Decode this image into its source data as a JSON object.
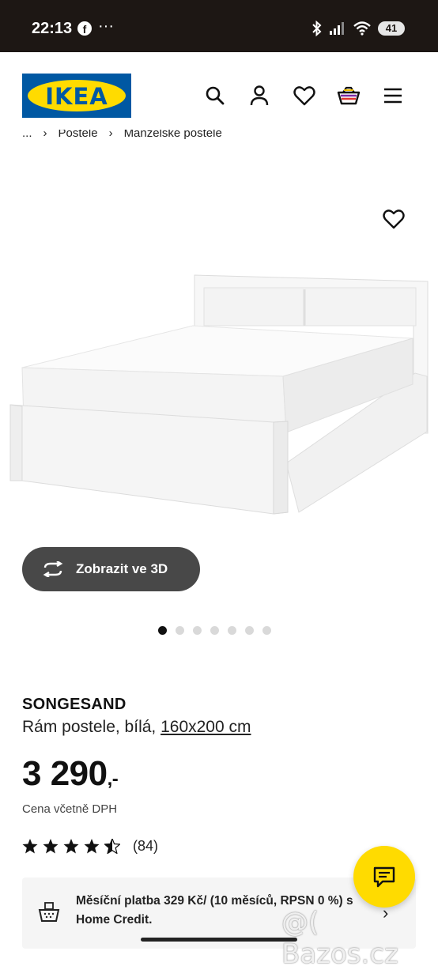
{
  "status_bar": {
    "time": "22:13",
    "facebook_glyph": "f",
    "more": "···",
    "battery": "41"
  },
  "header": {
    "logo_text": "IKEA",
    "icons": [
      "search-icon",
      "account-icon",
      "wishlist-icon",
      "cart-icon",
      "menu-icon"
    ]
  },
  "breadcrumb": {
    "items": [
      "...",
      "›",
      "Postele",
      "›",
      "Manželské postele"
    ]
  },
  "gallery": {
    "view3d_label": "Zobrazit ve 3D",
    "dots_total": 7,
    "active_dot": 0
  },
  "product": {
    "name": "SONGESAND",
    "description": "Rám postele, bílá, ",
    "size": "160x200 cm",
    "price": "3 290",
    "price_suffix": ",-",
    "price_note": "Cena včetně DPH",
    "rating": 4.5,
    "reviews": "(84)"
  },
  "finance": {
    "text": "Měsíční platba 329 Kč/ (10 měsíců, RPSN 0 %) s Home Credit."
  },
  "watermark": "@( Bazos.cz",
  "colors": {
    "ikea_blue": "#0058a3",
    "ikea_yellow": "#ffdb00",
    "status_bar_bg": "#1d1714",
    "button_dark": "#484848"
  }
}
